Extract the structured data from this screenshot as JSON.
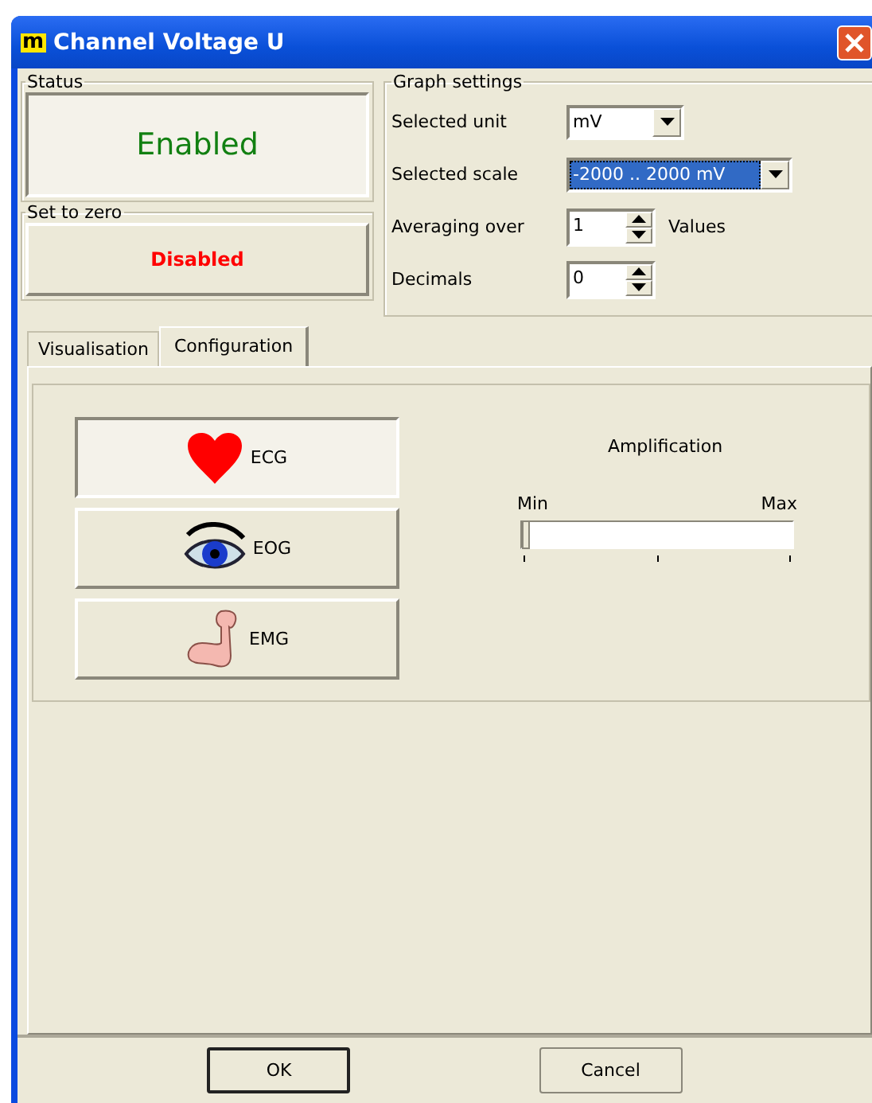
{
  "window": {
    "logo": "m",
    "title": "Channel Voltage U"
  },
  "status": {
    "label": "Status",
    "value": "Enabled"
  },
  "set_to_zero": {
    "label": "Set to zero",
    "value": "Disabled"
  },
  "graph_settings": {
    "label": "Graph settings",
    "fields": [
      {
        "kind": "dropdown",
        "label": "Selected unit",
        "value": "mV",
        "highlighted": false,
        "wide": false
      },
      {
        "kind": "dropdown",
        "label": "Selected scale",
        "value": "-2000 .. 2000 mV",
        "highlighted": true,
        "wide": true
      },
      {
        "kind": "spin",
        "label": "Averaging over",
        "value": "1",
        "suffix": "Values"
      },
      {
        "kind": "spin",
        "label": "Decimals",
        "value": "0"
      }
    ]
  },
  "tabs": [
    {
      "label": "Visualisation",
      "selected": false
    },
    {
      "label": "Configuration",
      "selected": true
    }
  ],
  "modes": [
    {
      "kind": "heart",
      "label": "ECG",
      "selected": true
    },
    {
      "kind": "eye",
      "label": "EOG",
      "selected": false
    },
    {
      "kind": "arm",
      "label": "EMG",
      "selected": false
    }
  ],
  "amplification": {
    "label": "Amplification",
    "min_label": "Min",
    "max_label": "Max",
    "level": 0
  },
  "buttons": [
    {
      "label": "OK",
      "default": true
    },
    {
      "label": "Cancel",
      "default": false
    }
  ]
}
